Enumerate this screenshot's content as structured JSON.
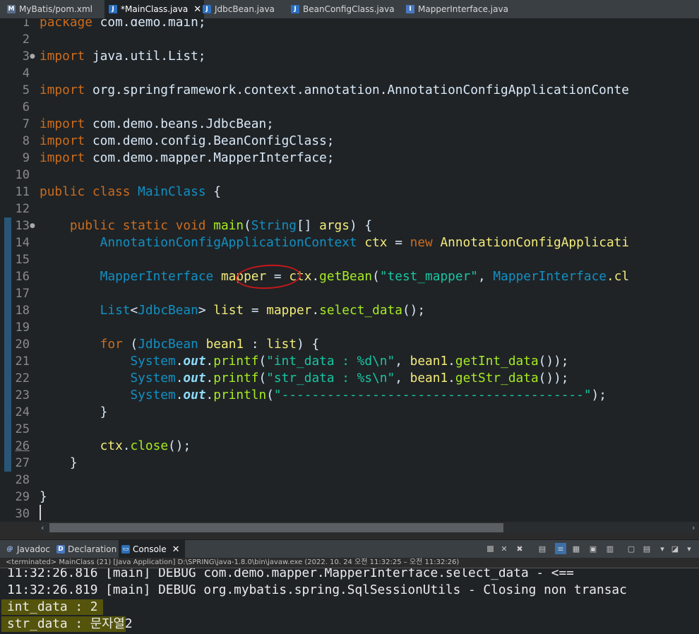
{
  "editor_tabs": [
    {
      "label": "MyBatis/pom.xml",
      "icon": "maven-file-icon",
      "active": false,
      "dirty": false
    },
    {
      "label": "*MainClass.java",
      "icon": "java-file-icon",
      "active": true,
      "dirty": true
    },
    {
      "label": "JdbcBean.java",
      "icon": "java-file-icon",
      "active": false,
      "dirty": false
    },
    {
      "label": "BeanConfigClass.java",
      "icon": "java-file-icon",
      "active": false,
      "dirty": false
    },
    {
      "label": "MapperInterface.java",
      "icon": "java-file-icon",
      "active": false,
      "dirty": false
    }
  ],
  "colors": {
    "keyword": "#cc6c1d",
    "class": "#1290c3",
    "plain": "#d9e8f7",
    "string": "#17c6a3",
    "method": "#a7ec21",
    "field": "#8ddaf8",
    "variable": "#f3ec79",
    "line_number": "#8a8a8a",
    "highlight": "#5a5a0a",
    "annotation_circle": "#c8171a"
  },
  "code": {
    "lines": [
      {
        "n": 1,
        "tokens": [
          {
            "t": "package ",
            "c": "keyword"
          },
          {
            "t": "com.demo.main;",
            "c": "plain"
          }
        ]
      },
      {
        "n": 2,
        "tokens": []
      },
      {
        "n": 3,
        "fold": true,
        "tokens": [
          {
            "t": "import ",
            "c": "keyword"
          },
          {
            "t": "java.util.List;",
            "c": "plain"
          }
        ]
      },
      {
        "n": 4,
        "tokens": []
      },
      {
        "n": 5,
        "tokens": [
          {
            "t": "import ",
            "c": "keyword"
          },
          {
            "t": "org.springframework.context.annotation.AnnotationConfigApplicationConte",
            "c": "plain"
          }
        ]
      },
      {
        "n": 6,
        "tokens": []
      },
      {
        "n": 7,
        "tokens": [
          {
            "t": "import ",
            "c": "keyword"
          },
          {
            "t": "com.demo.beans.JdbcBean;",
            "c": "plain"
          }
        ]
      },
      {
        "n": 8,
        "tokens": [
          {
            "t": "import ",
            "c": "keyword"
          },
          {
            "t": "com.demo.config.BeanConfigClass;",
            "c": "plain"
          }
        ]
      },
      {
        "n": 9,
        "tokens": [
          {
            "t": "import ",
            "c": "keyword"
          },
          {
            "t": "com.demo.mapper.MapperInterface;",
            "c": "plain"
          }
        ]
      },
      {
        "n": 10,
        "tokens": []
      },
      {
        "n": 11,
        "tokens": [
          {
            "t": "public class ",
            "c": "keyword"
          },
          {
            "t": "MainClass",
            "c": "class"
          },
          {
            "t": " {",
            "c": "plain"
          }
        ]
      },
      {
        "n": 12,
        "tokens": []
      },
      {
        "n": 13,
        "fold": true,
        "tokens": [
          {
            "t": "    public static void ",
            "c": "keyword"
          },
          {
            "t": "main",
            "c": "method"
          },
          {
            "t": "(",
            "c": "plain"
          },
          {
            "t": "String",
            "c": "class"
          },
          {
            "t": "[] ",
            "c": "plain"
          },
          {
            "t": "args",
            "c": "variable"
          },
          {
            "t": ") {",
            "c": "plain"
          }
        ]
      },
      {
        "n": 14,
        "tokens": [
          {
            "t": "        ",
            "c": "plain"
          },
          {
            "t": "AnnotationConfigApplicationContext",
            "c": "class"
          },
          {
            "t": " ",
            "c": "plain"
          },
          {
            "t": "ctx",
            "c": "variable"
          },
          {
            "t": " = ",
            "c": "plain"
          },
          {
            "t": "new ",
            "c": "keyword"
          },
          {
            "t": "AnnotationConfigApplicati",
            "c": "variable"
          }
        ]
      },
      {
        "n": 15,
        "tokens": []
      },
      {
        "n": 16,
        "tokens": [
          {
            "t": "        ",
            "c": "plain"
          },
          {
            "t": "MapperInterface",
            "c": "class"
          },
          {
            "t": " ",
            "c": "plain"
          },
          {
            "t": "mapper",
            "c": "variable"
          },
          {
            "t": " = ",
            "c": "plain"
          },
          {
            "t": "ctx",
            "c": "variable"
          },
          {
            "t": ".",
            "c": "plain"
          },
          {
            "t": "getBean",
            "c": "method"
          },
          {
            "t": "(",
            "c": "plain"
          },
          {
            "t": "\"test_mapper\"",
            "c": "string"
          },
          {
            "t": ", ",
            "c": "plain"
          },
          {
            "t": "MapperInterface",
            "c": "class"
          },
          {
            "t": ".cl",
            "c": "variable"
          }
        ]
      },
      {
        "n": 17,
        "tokens": []
      },
      {
        "n": 18,
        "tokens": [
          {
            "t": "        ",
            "c": "plain"
          },
          {
            "t": "List",
            "c": "class"
          },
          {
            "t": "<",
            "c": "plain"
          },
          {
            "t": "JdbcBean",
            "c": "class"
          },
          {
            "t": "> ",
            "c": "plain"
          },
          {
            "t": "list",
            "c": "variable"
          },
          {
            "t": " = ",
            "c": "plain"
          },
          {
            "t": "mapper",
            "c": "variable"
          },
          {
            "t": ".",
            "c": "plain"
          },
          {
            "t": "select_data",
            "c": "method"
          },
          {
            "t": "();",
            "c": "plain"
          }
        ]
      },
      {
        "n": 19,
        "tokens": []
      },
      {
        "n": 20,
        "tokens": [
          {
            "t": "        ",
            "c": "plain"
          },
          {
            "t": "for ",
            "c": "keyword"
          },
          {
            "t": "(",
            "c": "plain"
          },
          {
            "t": "JdbcBean",
            "c": "class"
          },
          {
            "t": " ",
            "c": "plain"
          },
          {
            "t": "bean1",
            "c": "variable"
          },
          {
            "t": " : ",
            "c": "plain"
          },
          {
            "t": "list",
            "c": "variable"
          },
          {
            "t": ") {",
            "c": "plain"
          }
        ]
      },
      {
        "n": 21,
        "tokens": [
          {
            "t": "            ",
            "c": "plain"
          },
          {
            "t": "System",
            "c": "class"
          },
          {
            "t": ".",
            "c": "plain"
          },
          {
            "t": "out",
            "c": "field",
            "style": "bi"
          },
          {
            "t": ".",
            "c": "plain"
          },
          {
            "t": "printf",
            "c": "method"
          },
          {
            "t": "(",
            "c": "plain"
          },
          {
            "t": "\"int_data : %d\\n\"",
            "c": "string"
          },
          {
            "t": ", ",
            "c": "plain"
          },
          {
            "t": "bean1",
            "c": "variable"
          },
          {
            "t": ".",
            "c": "plain"
          },
          {
            "t": "getInt_data",
            "c": "method"
          },
          {
            "t": "());",
            "c": "plain"
          }
        ]
      },
      {
        "n": 22,
        "tokens": [
          {
            "t": "            ",
            "c": "plain"
          },
          {
            "t": "System",
            "c": "class"
          },
          {
            "t": ".",
            "c": "plain"
          },
          {
            "t": "out",
            "c": "field",
            "style": "bi"
          },
          {
            "t": ".",
            "c": "plain"
          },
          {
            "t": "printf",
            "c": "method"
          },
          {
            "t": "(",
            "c": "plain"
          },
          {
            "t": "\"str_data : %s\\n\"",
            "c": "string"
          },
          {
            "t": ", ",
            "c": "plain"
          },
          {
            "t": "bean1",
            "c": "variable"
          },
          {
            "t": ".",
            "c": "plain"
          },
          {
            "t": "getStr_data",
            "c": "method"
          },
          {
            "t": "());",
            "c": "plain"
          }
        ]
      },
      {
        "n": 23,
        "tokens": [
          {
            "t": "            ",
            "c": "plain"
          },
          {
            "t": "System",
            "c": "class"
          },
          {
            "t": ".",
            "c": "plain"
          },
          {
            "t": "out",
            "c": "field",
            "style": "bi"
          },
          {
            "t": ".",
            "c": "plain"
          },
          {
            "t": "println",
            "c": "method"
          },
          {
            "t": "(",
            "c": "plain"
          },
          {
            "t": "\"----------------------------------------\"",
            "c": "string"
          },
          {
            "t": ");",
            "c": "plain"
          }
        ]
      },
      {
        "n": 24,
        "tokens": [
          {
            "t": "        }",
            "c": "plain"
          }
        ]
      },
      {
        "n": 25,
        "tokens": []
      },
      {
        "n": 26,
        "underline": true,
        "tokens": [
          {
            "t": "        ",
            "c": "plain"
          },
          {
            "t": "ctx",
            "c": "variable"
          },
          {
            "t": ".",
            "c": "plain"
          },
          {
            "t": "close",
            "c": "method"
          },
          {
            "t": "();",
            "c": "plain"
          }
        ]
      },
      {
        "n": 27,
        "tokens": [
          {
            "t": "    }",
            "c": "plain"
          }
        ]
      },
      {
        "n": 28,
        "tokens": []
      },
      {
        "n": 29,
        "tokens": [
          {
            "t": "}",
            "c": "plain"
          }
        ]
      },
      {
        "n": 30,
        "tokens": []
      }
    ]
  },
  "panel_tabs": [
    {
      "label": "Javadoc",
      "icon": "javadoc-icon",
      "active": false
    },
    {
      "label": "Declaration",
      "icon": "declaration-icon",
      "active": false
    },
    {
      "label": "Console",
      "icon": "console-icon",
      "active": true
    }
  ],
  "console_toolbar": [
    "terminate-icon",
    "remove-launch-icon",
    "remove-all-terminated-icon",
    "scroll-lock-icon",
    "word-wrap-icon",
    "show-stdout-icon",
    "show-stderr-icon",
    "pin-console-icon",
    "display-console-icon",
    "open-console-icon"
  ],
  "console": {
    "header": "<terminated> MainClass (21) [Java Application] D:\\SPRING\\java-1.8.0\\bin\\javaw.exe  (2022. 10. 24 오전 11:32:25 – 오전 11:32:26)",
    "lines": [
      {
        "text": "11:32:26.816 [main] DEBUG com.demo.mapper.MapperInterface.select_data - <==      ",
        "highlight": false
      },
      {
        "text": "11:32:26.819 [main] DEBUG org.mybatis.spring.SqlSessionUtils - Closing non transac",
        "highlight": false
      },
      {
        "text": "int_data : 2",
        "highlight": true
      },
      {
        "text": "str_data : 문자열2",
        "highlight": true
      }
    ]
  }
}
